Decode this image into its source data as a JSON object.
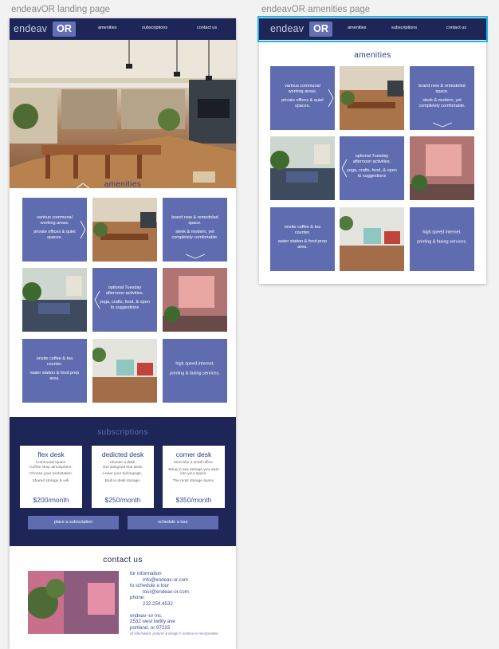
{
  "artboards": {
    "landing_label": "endeavOR landing page",
    "amenities_label": "endeavOR amenities page"
  },
  "nav": {
    "logo_text": "endeav",
    "logo_badge": "OR",
    "links": [
      "amenities",
      "subscriptions",
      "contact us"
    ]
  },
  "amenities": {
    "title": "amenities",
    "tiles": [
      {
        "lines": [
          "various communal working areas.",
          "private offices & quiet spaces."
        ],
        "chevron": "right"
      },
      {
        "lines": [
          "brand new & remodeled space.",
          "sleek & modern, yet completely comfortable."
        ],
        "chevron": "down"
      },
      {
        "lines": [
          "optional Tuesday afternoon activities.",
          "yoga, crafts, food, & open to suggestions"
        ],
        "chevron": "left"
      },
      {
        "lines": [
          "onsite coffee & tea counter.",
          "water station & food prep area."
        ],
        "chevron": "right"
      },
      {
        "lines": [
          "high speed internet.",
          "printing & faxing services."
        ],
        "chevron": "none"
      }
    ]
  },
  "subscriptions": {
    "title": "subscriptions",
    "plans": [
      {
        "name": "flex desk",
        "lines": [
          "Communal space.",
          "Coffee shop atmosphere.",
          "Choose your workstation.",
          "Shared storage & wifi."
        ],
        "price": "$200/month"
      },
      {
        "name": "dedicted desk",
        "lines": [
          "Choose a desk.",
          "Get assigned that desk.",
          "Leave your belongings..",
          "Built in desk storage."
        ],
        "price": "$250/month"
      },
      {
        "name": "corner desk",
        "lines": [
          "More like a small office.",
          "Bring in any storage you want into your space.",
          "The most storage space."
        ],
        "price": "$350/month"
      }
    ],
    "buttons": [
      "place a subscription",
      "schedule a tour"
    ]
  },
  "contact": {
    "title": "contact us",
    "info_label": "for information",
    "info_email": "info@endeav-or.com",
    "tour_label": "to schedule a tour",
    "tour_email": "tour@endeav-or.com",
    "phone_label": "phone:",
    "phone": "232.254.4532",
    "company": "endeav~or inc.",
    "street": "2532 west twility ave",
    "city": "portland, or 97233",
    "copyright": "all information, pictures & design © endeav~or incorporated"
  },
  "colors": {
    "navy": "#1d2657",
    "tile_blue": "#5f6cb0",
    "title_blue": "#2e3a86",
    "selection": "#19b2ee"
  }
}
